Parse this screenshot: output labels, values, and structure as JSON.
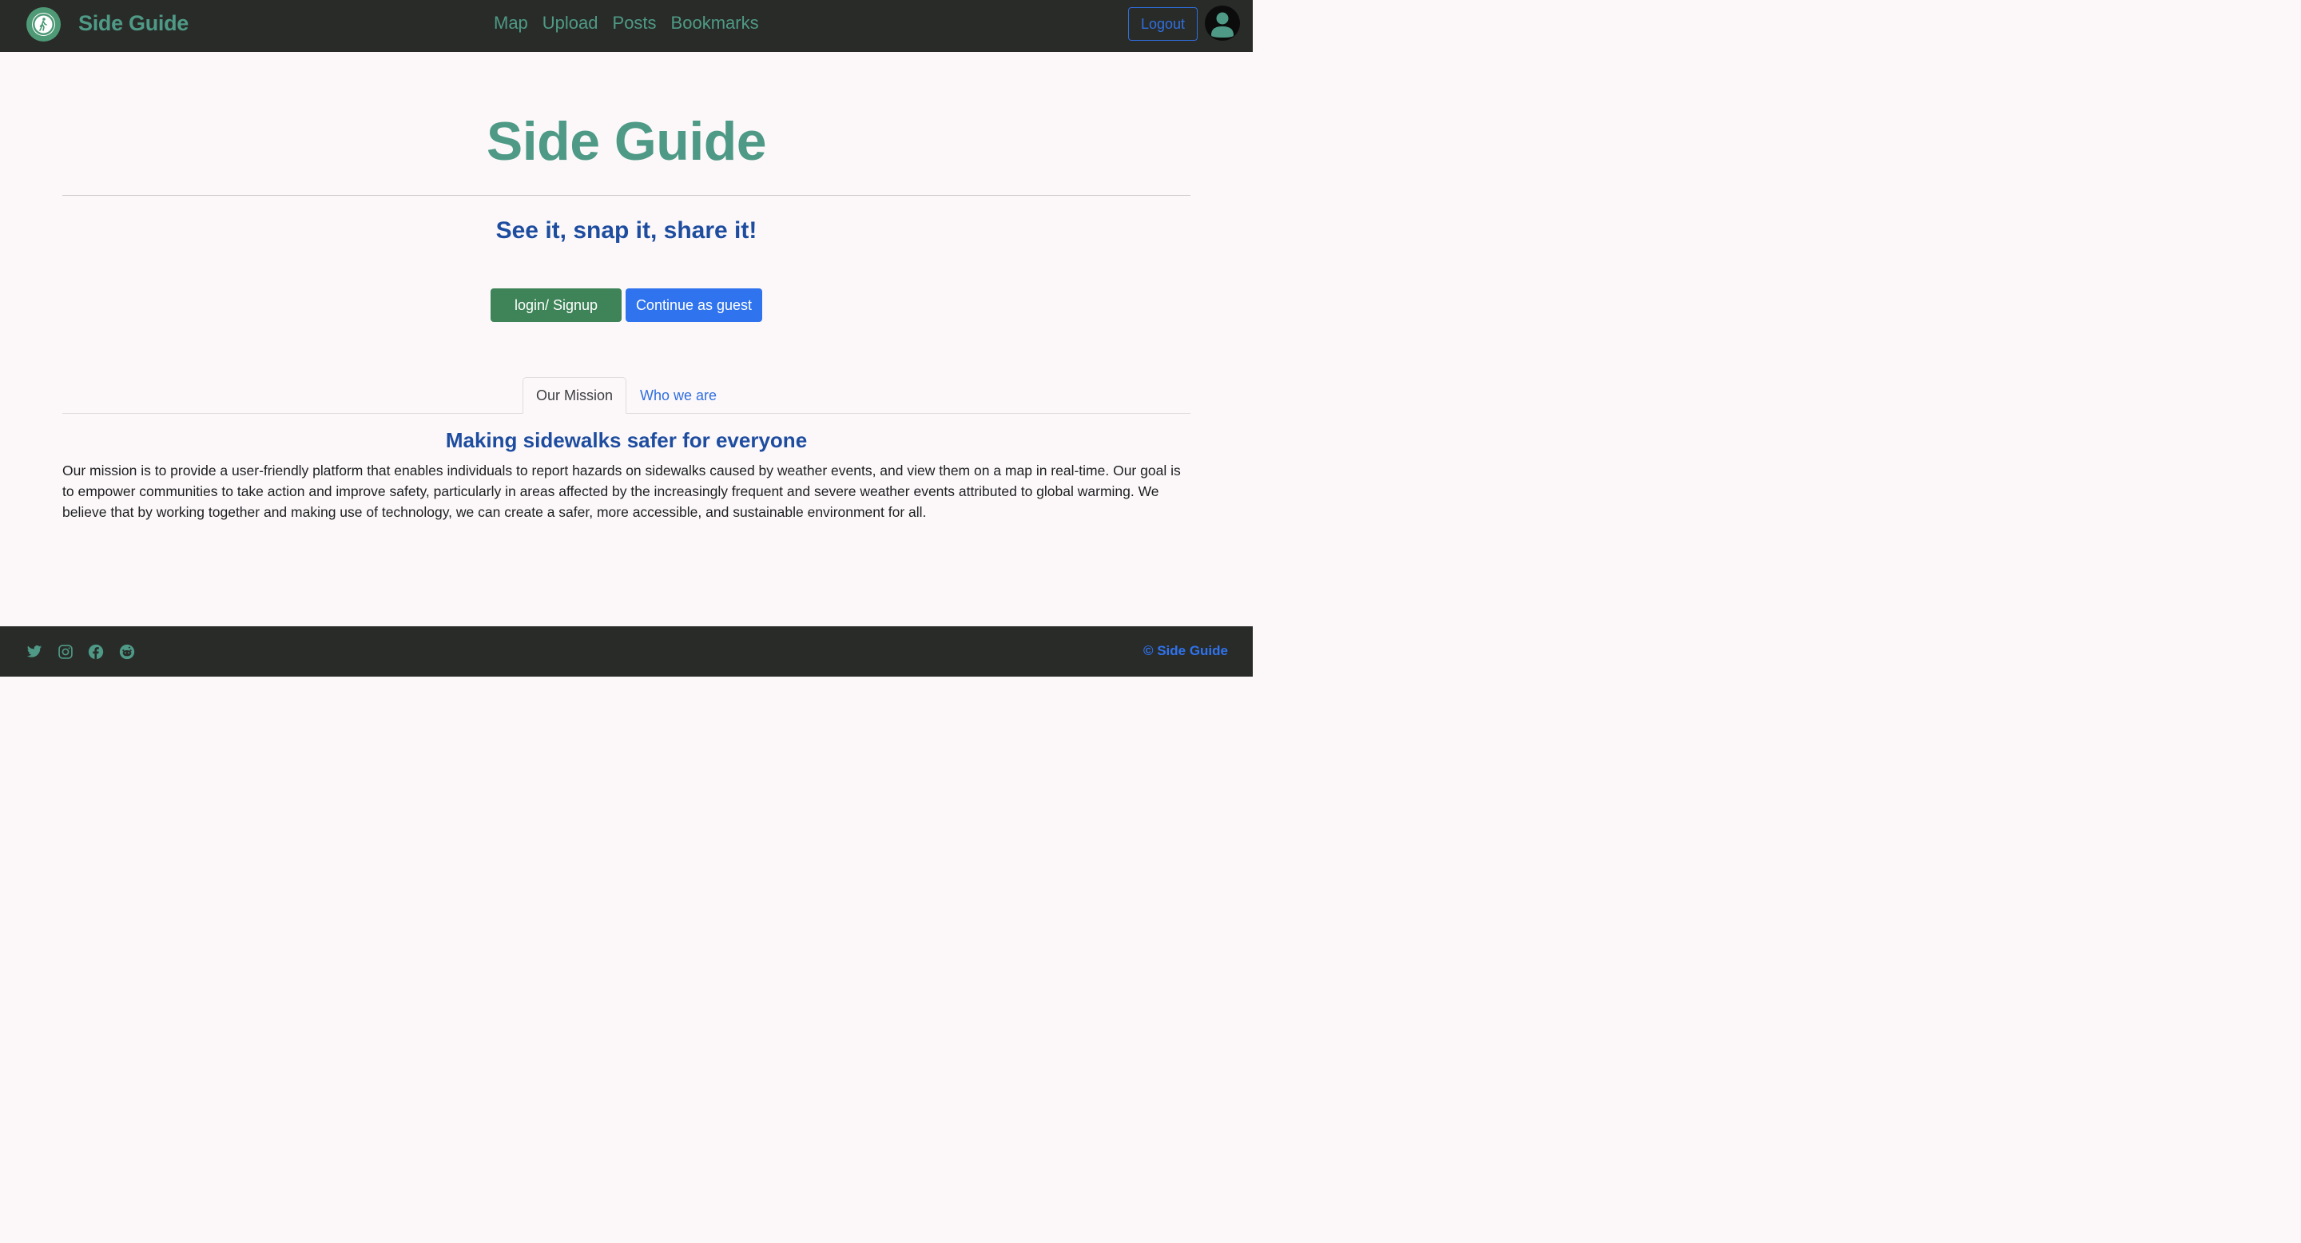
{
  "header": {
    "brand_name": "Side Guide",
    "nav": [
      "Map",
      "Upload",
      "Posts",
      "Bookmarks"
    ],
    "logout_label": "Logout",
    "logo_icon": "walking-person-icon",
    "avatar_icon": "user-avatar-icon"
  },
  "hero": {
    "title": "Side Guide",
    "tagline": "See it, snap it, share it!",
    "login_label": "login/ Signup",
    "guest_label": "Continue as guest"
  },
  "tabs": {
    "active": "Our Mission",
    "inactive": "Who we are"
  },
  "mission": {
    "heading": "Making sidewalks safer for everyone",
    "text": "Our mission is to provide a user-friendly platform that enables individuals to report hazards on sidewalks caused by weather events, and view them on a map in real-time. Our goal is to empower communities to take action and improve safety, particularly in areas affected by the increasingly frequent and severe weather events attributed to global warming. We believe that by working together and making use of technology, we can create a safer, more accessible, and sustainable environment for all."
  },
  "footer": {
    "social_icons": [
      "twitter-icon",
      "instagram-icon",
      "facebook-icon",
      "reddit-icon"
    ],
    "copyright": "© Side Guide"
  },
  "colors": {
    "navbar_bg": "#292b28",
    "brand_green": "#4e9a86",
    "heading_blue": "#1e4da0",
    "login_green": "#3e8458",
    "guest_blue": "#2f73ee",
    "page_bg": "#fcf8f9"
  }
}
